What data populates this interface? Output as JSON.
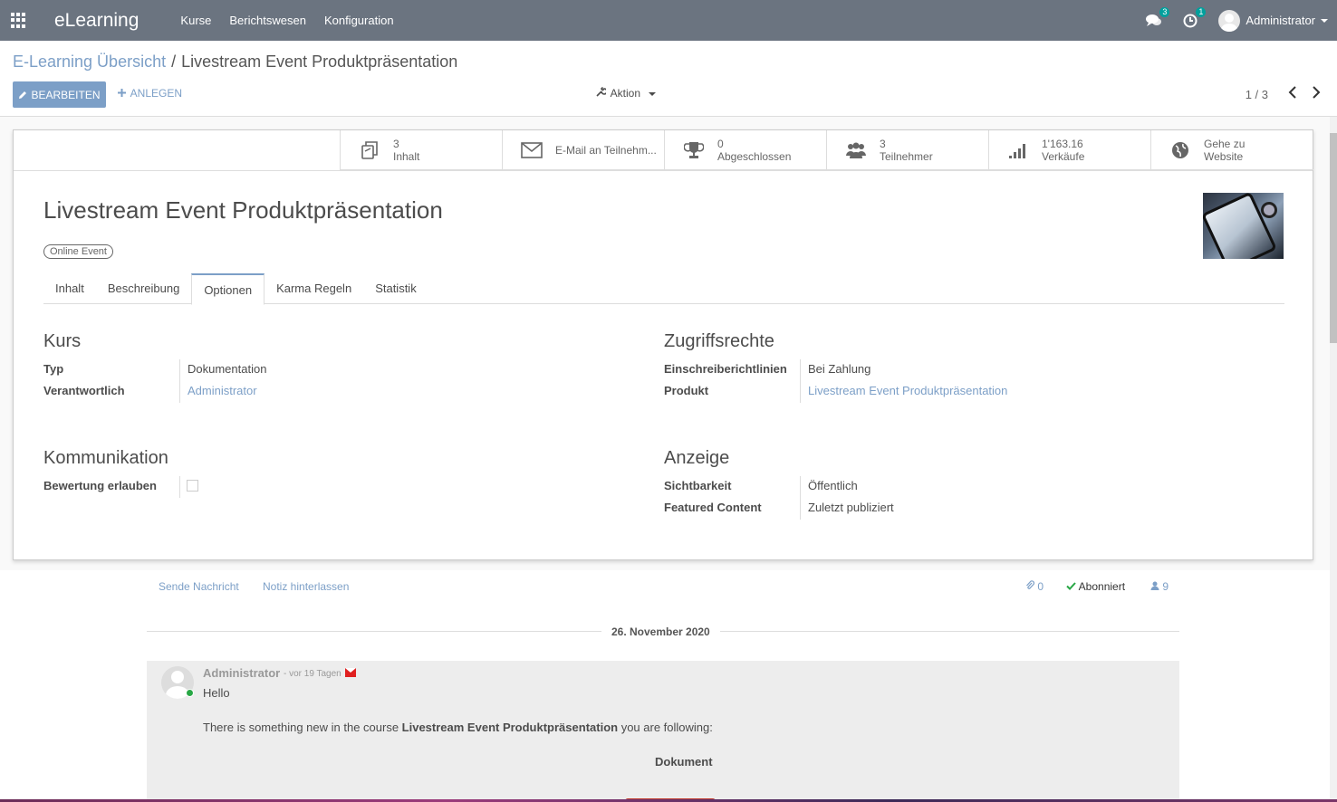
{
  "navbar": {
    "brand": "eLearning",
    "menu": [
      "Kurse",
      "Berichtswesen",
      "Konfiguration"
    ],
    "messages_count": "3",
    "activities_count": "1",
    "user": "Administrator"
  },
  "control": {
    "breadcrumb_parent": "E-Learning Übersicht",
    "breadcrumb_sep": "/",
    "breadcrumb_current": "Livestream Event Produktpräsentation",
    "edit_label": "BEARBEITEN",
    "create_label": "ANLEGEN",
    "action_label": "Aktion",
    "pager": "1 / 3"
  },
  "stats": [
    {
      "value": "3",
      "label": "Inhalt",
      "icon": "documents-icon"
    },
    {
      "value": "",
      "label": "E-Mail an Teilnehm...",
      "icon": "envelope-icon"
    },
    {
      "value": "0",
      "label": "Abgeschlossen",
      "icon": "trophy-icon"
    },
    {
      "value": "3",
      "label": "Teilnehmer",
      "icon": "users-icon"
    },
    {
      "value": "1'163.16",
      "label": "Verkäufe",
      "icon": "signal-bars-icon"
    },
    {
      "value": "Gehe zu",
      "label": "Website",
      "icon": "globe-icon"
    }
  ],
  "record": {
    "title": "Livestream Event Produktpräsentation",
    "tag": "Online Event"
  },
  "tabs": [
    "Inhalt",
    "Beschreibung",
    "Optionen",
    "Karma Regeln",
    "Statistik"
  ],
  "groups": {
    "kurs": {
      "title": "Kurs",
      "typ_label": "Typ",
      "typ_value": "Dokumentation",
      "verantwortlich_label": "Verantwortlich",
      "verantwortlich_value": "Administrator"
    },
    "zugriff": {
      "title": "Zugriffsrechte",
      "einschreibe_label": "Einschreiberichtlinien",
      "einschreibe_value": "Bei Zahlung",
      "produkt_label": "Produkt",
      "produkt_value": "Livestream Event Produktpräsentation"
    },
    "kommunikation": {
      "title": "Kommunikation",
      "bewertung_label": "Bewertung erlauben"
    },
    "anzeige": {
      "title": "Anzeige",
      "sichtbarkeit_label": "Sichtbarkeit",
      "sichtbarkeit_value": "Öffentlich",
      "featured_label": "Featured Content",
      "featured_value": "Zuletzt publiziert"
    }
  },
  "chatter": {
    "send_message": "Sende Nachricht",
    "log_note": "Notiz hinterlassen",
    "attachments": "0",
    "subscribed": "Abonniert",
    "followers": "9",
    "date": "26. November 2020",
    "message": {
      "author": "Administrator",
      "time": "- vor 19 Tagen",
      "greeting": "Hello",
      "text_before": "There is something new in the course ",
      "course": "Livestream Event Produktpräsentation",
      "text_after": " you are following:",
      "doc": "Dokument"
    }
  }
}
